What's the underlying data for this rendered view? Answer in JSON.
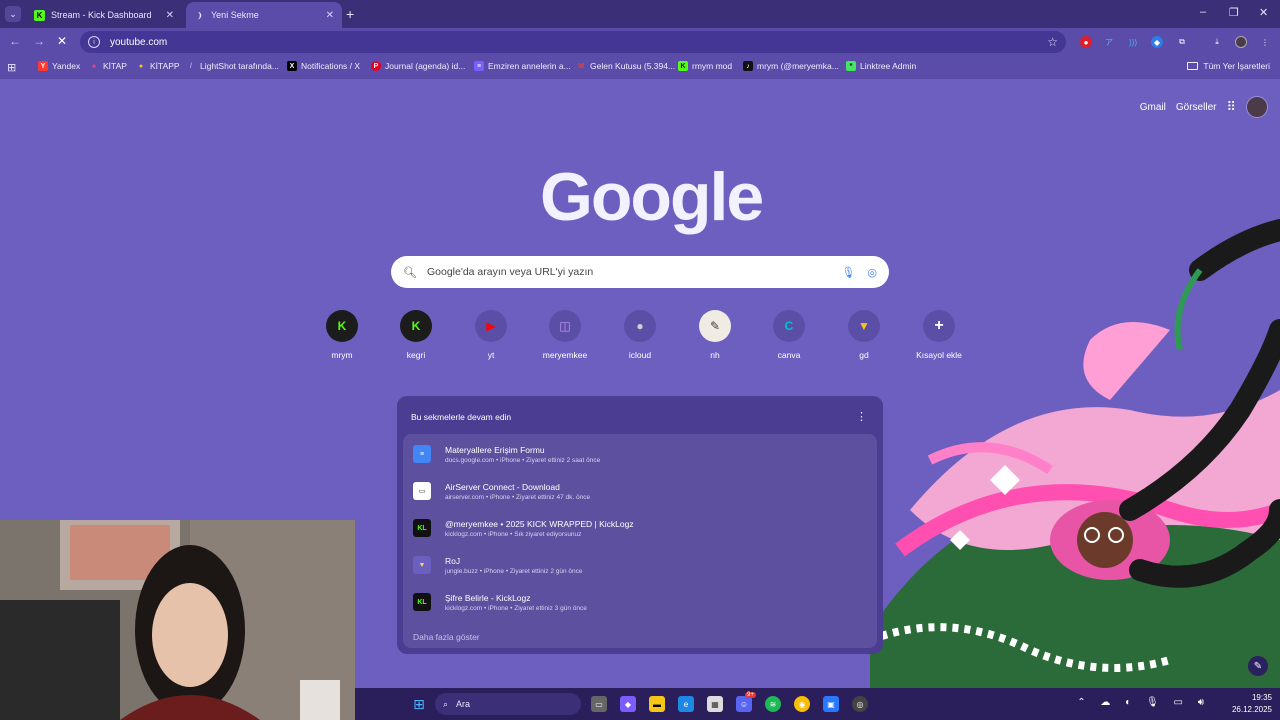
{
  "tabs": [
    {
      "title": "Stream - Kick Dashboard",
      "favicon": "kick-icon"
    },
    {
      "title": "Yeni Sekme",
      "favicon": "loading-spinner-icon"
    }
  ],
  "window": {
    "minimize": "–",
    "restore": "❐",
    "close": "✕"
  },
  "toolbar": {
    "url": "youtube.com"
  },
  "bookmarks": [
    {
      "label": "Yandex",
      "icon": "Y",
      "color": "#ff3b30"
    },
    {
      "label": "KİTAP",
      "icon": "K",
      "color": "#e94b8f"
    },
    {
      "label": "KİTAPP",
      "icon": "K",
      "color": "#f5c518"
    },
    {
      "label": "LightShot tarafında...",
      "icon": "/",
      "color": "#9b59ff"
    },
    {
      "label": "Notifications / X",
      "icon": "X",
      "color": "#000000"
    },
    {
      "label": "Journal (agenda) id...",
      "icon": "P",
      "color": "#e60023"
    },
    {
      "label": "Emziren annelerin a...",
      "icon": "≡",
      "color": "#7b5cff"
    },
    {
      "label": "Gelen Kutusu (5.394...",
      "icon": "M",
      "color": "#ea4335"
    },
    {
      "label": "rmym mod",
      "icon": "K",
      "color": "#53fc18"
    },
    {
      "label": "mrym (@meryemka...",
      "icon": "♪",
      "color": "#111111"
    },
    {
      "label": "Linktree Admin",
      "icon": "*",
      "color": "#43e660"
    }
  ],
  "bookmarks_all": "Tüm Yer İşaretleri",
  "ntp": {
    "gmail": "Gmail",
    "images": "Görseller",
    "logo": "Google",
    "search_placeholder": "Google'da arayın veya URL'yi yazın"
  },
  "shortcuts": [
    {
      "label": "mrym",
      "icon": "K",
      "color": "#53fc18",
      "bg": "#1c1c1c"
    },
    {
      "label": "kegri",
      "icon": "K",
      "color": "#53fc18",
      "bg": "#1c1c1c"
    },
    {
      "label": "yt",
      "icon": "▶",
      "color": "#ff0000",
      "bg": "#5b4ea6"
    },
    {
      "label": "meryemkee",
      "icon": "◫",
      "color": "#9146ff",
      "bg": "#5b4ea6"
    },
    {
      "label": "icloud",
      "icon": "",
      "color": "#d0d0d0",
      "bg": "#5b4ea6"
    },
    {
      "label": "nh",
      "icon": "✎",
      "color": "#3a3a3a",
      "bg": "#5b4ea6"
    },
    {
      "label": "canva",
      "icon": "C",
      "color": "#00c4cc",
      "bg": "#5b4ea6"
    },
    {
      "label": "gd",
      "icon": "▼",
      "color": "#f5c518",
      "bg": "#5b4ea6"
    },
    {
      "label": "Kısayol ekle",
      "icon": "+",
      "color": "#ffffff",
      "bg": "#5b4ea6"
    }
  ],
  "continue_card": {
    "title": "Bu sekmelerle devam edin",
    "items": [
      {
        "title": "Materyallere Erişim Formu",
        "meta": "docs.google.com • iPhone • Ziyaret ettiniz 2 saat önce",
        "icon": "≡",
        "color": "#4285f4"
      },
      {
        "title": "AirServer Connect - Download",
        "meta": "airserver.com • iPhone • Ziyaret ettiniz 47 dk. önce",
        "icon": "▭",
        "color": "#ffffff"
      },
      {
        "title": "@meryemkee • 2025 KICK WRAPPED | KickLogz",
        "meta": "kicklogz.com • iPhone • Sık ziyaret ediyorsunuz",
        "icon": "KL",
        "color": "#111111"
      },
      {
        "title": "RoJ",
        "meta": "jungle.buzz • iPhone • Ziyaret ettiniz 2 gün önce",
        "icon": "▼",
        "color": "#7b5cff"
      },
      {
        "title": "Şifre Belirle - KickLogz",
        "meta": "kicklogz.com • iPhone • Ziyaret ettiniz 3 gün önce",
        "icon": "KL",
        "color": "#111111"
      }
    ],
    "more": "Daha fazla göster"
  },
  "taskbar": {
    "search": "Ara",
    "time": "19:35",
    "date": "26.12.2025",
    "badge": "9+"
  }
}
